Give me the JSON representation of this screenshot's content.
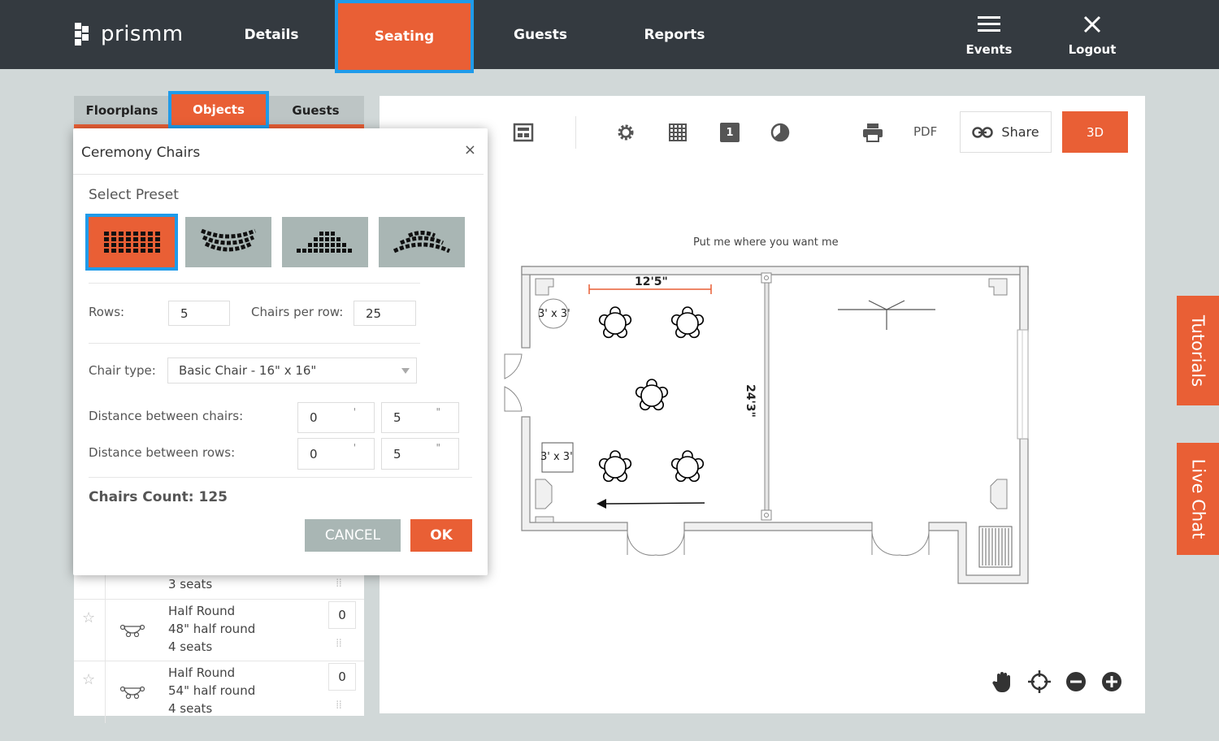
{
  "app": {
    "logo_text": "prismm"
  },
  "nav": {
    "items": [
      {
        "label": "Details"
      },
      {
        "label": "Seating"
      },
      {
        "label": "Guests"
      },
      {
        "label": "Reports"
      }
    ],
    "events_label": "Events",
    "logout_label": "Logout"
  },
  "left_panel": {
    "tabs": [
      {
        "label": "Floorplans"
      },
      {
        "label": "Objects"
      },
      {
        "label": "Guests"
      }
    ],
    "partial_row": {
      "seats": "3 seats"
    },
    "objects": [
      {
        "name": "Half Round",
        "size": "48\" half round",
        "seats": "4 seats",
        "count": "0"
      },
      {
        "name": "Half Round",
        "size": "54\" half round",
        "seats": "4 seats",
        "count": "0"
      }
    ]
  },
  "modal": {
    "title": "Ceremony Chairs",
    "close_glyph": "×",
    "preset_title": "Select Preset",
    "rows_label": "Rows:",
    "rows_value": "5",
    "chairs_per_row_label": "Chairs per row:",
    "chairs_per_row_value": "25",
    "chair_type_label": "Chair type:",
    "chair_type_value": "Basic Chair - 16\" x 16\"",
    "distance_chairs_label": "Distance between chairs:",
    "distance_chairs_feet": "0",
    "distance_chairs_inches": "5",
    "distance_rows_label": "Distance between rows:",
    "distance_rows_feet": "0",
    "distance_rows_inches": "5",
    "feet_unit": "'",
    "inch_unit": "\"",
    "chairs_count_label": "Chairs Count: 125",
    "cancel_label": "CANCEL",
    "ok_label": "OK"
  },
  "toolbar": {
    "pdf_label": "PDF",
    "page_number": "1",
    "share_label": "Share",
    "view3d_label": "3D"
  },
  "floorplan": {
    "hint": "Put me where you want me",
    "width_dim": "12'5\"",
    "height_dim": "24'3\"",
    "round_table_label": "3' x 3'",
    "square_table_label": "3' x 3'"
  },
  "side_tabs": {
    "tutorials": "Tutorials",
    "live_chat": "Live Chat"
  },
  "colors": {
    "accent": "#e95f35",
    "topbar": "#343a40",
    "highlight": "#1f9bea",
    "preset_bg": "#a9b6b4"
  }
}
